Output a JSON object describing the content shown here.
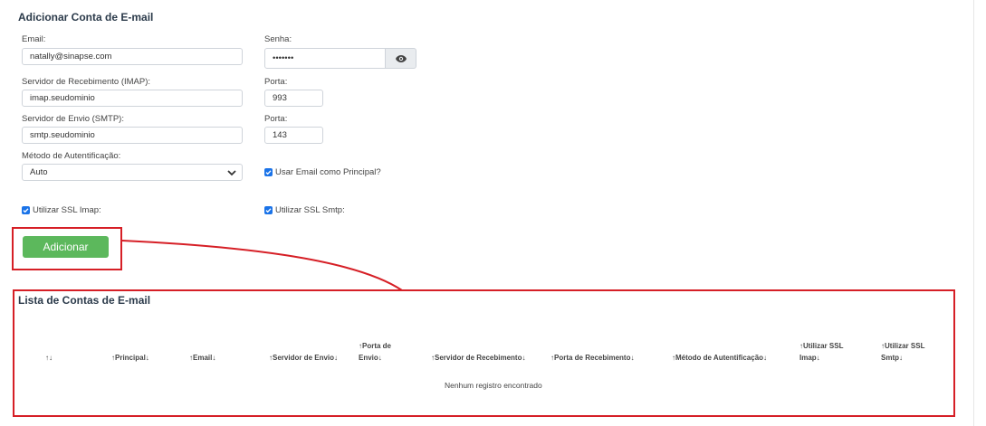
{
  "form": {
    "title": "Adicionar Conta de E-mail",
    "email_label": "Email:",
    "email_value": "natally@sinapse.com",
    "senha_label": "Senha:",
    "senha_value": "•••••••",
    "imap_label": "Servidor de Recebimento (IMAP):",
    "imap_value": "imap.seudominio",
    "porta_imap_label": "Porta:",
    "porta_imap_value": "993",
    "smtp_label": "Servidor de Envio (SMTP):",
    "smtp_value": "smtp.seudominio",
    "porta_smtp_label": "Porta:",
    "porta_smtp_value": "143",
    "auth_label": "Método de Autentificação:",
    "auth_value": "Auto",
    "principal_label": "Usar Email como Principal?",
    "ssl_imap_label": "Utilizar SSL Imap:",
    "ssl_smtp_label": "Utilizar SSL Smtp:",
    "add_button": "Adicionar"
  },
  "list": {
    "title": "Lista de Contas de E-mail",
    "columns": [
      "↑↓",
      "↑Principal↓",
      "↑Email↓",
      "↑Servidor de Envio↓",
      "↑Porta de",
      "Envio↓",
      "↑Servidor de Recebimento↓",
      "↑Porta de Recebimento↓",
      "↑Método de Autentificação↓",
      "↑Utilizar SSL",
      "Imap↓",
      "↑Utilizar SSL",
      "Smtp↓"
    ],
    "empty_text": "Nenhum registro encontrado"
  },
  "icons": {
    "password_toggle": "eye-icon",
    "select": "chevron-down-icon",
    "checkbox": "checkmark-icon"
  },
  "colors": {
    "accent": "#5cb85c",
    "highlight": "#d61f26",
    "checkbox": "#1a73e8"
  }
}
